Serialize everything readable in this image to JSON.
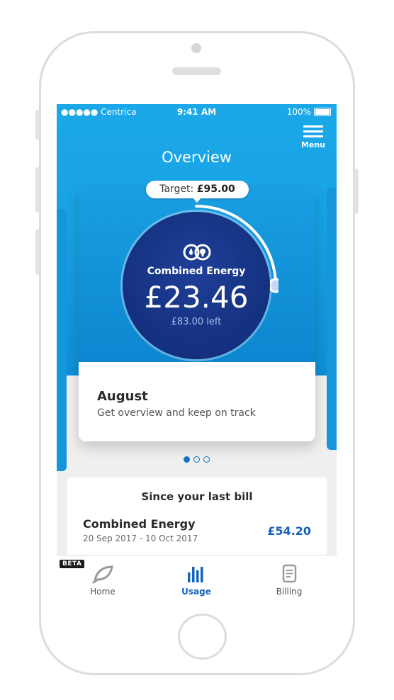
{
  "status_bar": {
    "carrier": "●●●●● Centrica",
    "time": "9:41 AM",
    "battery": "100%"
  },
  "header": {
    "title": "Overview",
    "menu_label": "Menu"
  },
  "overview_card": {
    "target_label": "Target:",
    "target_value": "£95.00",
    "fuel_label": "Combined Energy",
    "spent": "£23.46",
    "remaining": "£83.00 left",
    "progress_fraction": 0.25,
    "month": "August",
    "subtitle": "Get overview and keep on track"
  },
  "pagination": {
    "pages": 3,
    "active": 0
  },
  "last_bill": {
    "title": "Since your last bill",
    "fuel_label": "Combined Energy",
    "dates": "20 Sep 2017 - 10 Oct 2017",
    "amount": "£54.20"
  },
  "tabbar": {
    "beta_badge": "BETA",
    "tabs": [
      {
        "label": "Home",
        "icon": "leaf-icon"
      },
      {
        "label": "Usage",
        "icon": "bar-chart-icon",
        "active": true
      },
      {
        "label": "Billing",
        "icon": "bill-icon"
      }
    ]
  },
  "colors": {
    "primary_blue": "#1ba8e8",
    "dark_navy": "#14307f",
    "accent_blue": "#1464ba"
  }
}
